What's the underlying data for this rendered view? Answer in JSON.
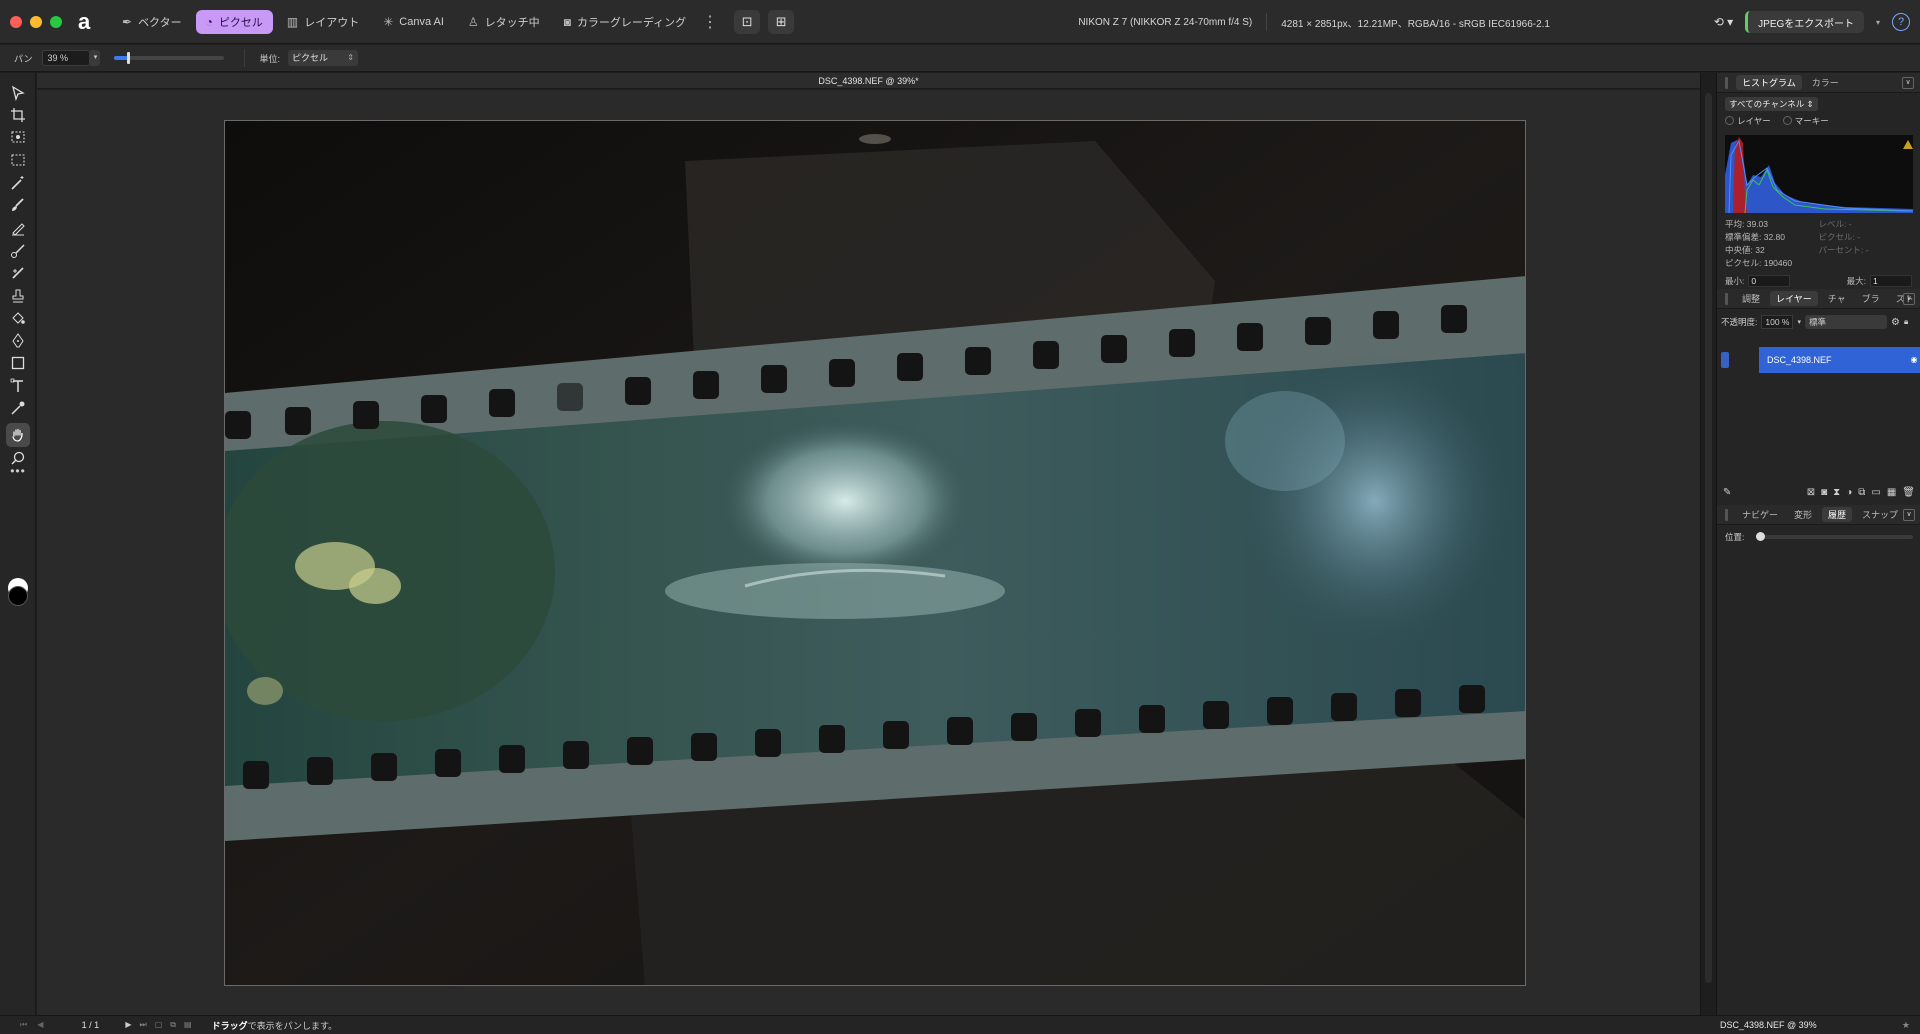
{
  "app": {
    "modes": [
      {
        "label": "ベクター",
        "icon": "pen-nib-icon"
      },
      {
        "label": "ピクセル",
        "icon": "pixel-brush-icon"
      },
      {
        "label": "レイアウト",
        "icon": "layout-icon"
      },
      {
        "label": "Canva AI",
        "icon": "sparkle-icon"
      },
      {
        "label": "レタッチ中",
        "icon": "person-icon"
      },
      {
        "label": "カラーグレーディング",
        "icon": "camera-icon"
      }
    ],
    "active_mode": "ピクセル",
    "camera_info": "NIKON Z 7 (NIKKOR Z 24-70mm f/4 S)",
    "image_info": "4281 × 2851px、12.21MP、RGBA/16 - sRGB IEC61966-2.1",
    "export_label": "JPEGをエクスポート",
    "help_label": "?"
  },
  "context": {
    "tool_label": "パン",
    "zoom_value": "39 %",
    "unit_label": "単位:",
    "unit_value": "ピクセル"
  },
  "document": {
    "title": "DSC_4398.NEF @ 39%*"
  },
  "histogram_panel": {
    "tabs": [
      "ヒストグラム",
      "カラー"
    ],
    "channel": "すべてのチャンネル",
    "radio_layer": "レイヤー",
    "radio_marquee": "マーキー",
    "stats_left": [
      "平均: 39.03",
      "標準偏差: 32.80",
      "中央値: 32",
      "ピクセル: 190460"
    ],
    "stats_right": [
      "レベル: -",
      "ピクセル: -",
      "パーセント: -"
    ],
    "min_label": "最小:",
    "min_value": "0",
    "max_label": "最大:",
    "max_value": "1"
  },
  "layers_panel": {
    "tabs": [
      "調整",
      "レイヤー",
      "チャ",
      "ブラ",
      "スト"
    ],
    "opacity_label": "不透明度:",
    "opacity_value": "100 %",
    "blend_mode": "標準",
    "layer_name": "DSC_4398.NEF"
  },
  "navigator_panel": {
    "tabs": [
      "ナビゲー",
      "変形",
      "履歴",
      "スナップ"
    ],
    "position_label": "位置:"
  },
  "status": {
    "page": "1 / 1",
    "message_bold": "ドラッグ",
    "message_rest": "で表示をパンします。",
    "doc_info": "DSC_4398.NEF @ 39%"
  },
  "colors": {
    "accent_mode": "#c89af6",
    "layer_selected": "#2f63d6",
    "export_indicator": "#5fd068"
  }
}
